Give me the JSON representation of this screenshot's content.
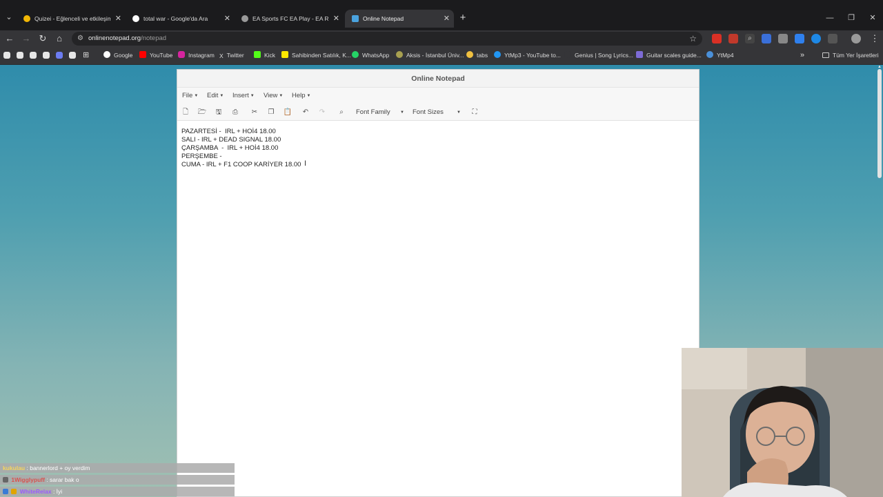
{
  "browser": {
    "tabs": [
      {
        "title": "Quizei - Eğlenceli ve etkileşimli",
        "active": false,
        "fav_color": "#f2b705"
      },
      {
        "title": "total war - Google'da Ara",
        "active": false,
        "fav_color": "#ffffff"
      },
      {
        "title": "EA Sports FC EA Play - EA Resm",
        "active": false,
        "fav_color": "#9a9a9a"
      },
      {
        "title": "Online Notepad",
        "active": true,
        "fav_color": "#4aa3df"
      }
    ],
    "new_tab": "+",
    "window_controls": {
      "minimize": "—",
      "restore": "❐",
      "close": "✕"
    },
    "address": {
      "host": "onlinenotepad.org",
      "path": "/notepad"
    },
    "bookmarks": [
      {
        "label": "Google",
        "icon_color": "#ffffff"
      },
      {
        "label": "YouTube",
        "icon_color": "#ff0000"
      },
      {
        "label": "Instagram",
        "icon_color": "#d6249f"
      },
      {
        "label": "Twitter",
        "icon_color": "#dddddd"
      },
      {
        "label": "Kick",
        "icon_color": "#53fc18"
      },
      {
        "label": "Sahibinden Satılık, K...",
        "icon_color": "#ffe800"
      },
      {
        "label": "WhatsApp",
        "icon_color": "#25d366"
      },
      {
        "label": "Aksis - İstanbul Üniv...",
        "icon_color": "#a8a050"
      },
      {
        "label": "tabs",
        "icon_color": "#f0c040"
      },
      {
        "label": "YtMp3 - YouTube to...",
        "icon_color": "#2196f3"
      },
      {
        "label": "Genius | Song Lyrics...",
        "icon_color": "#353538"
      },
      {
        "label": "Guitar scales guide...",
        "icon_color": "#7d6bd6"
      },
      {
        "label": "YtMp4",
        "icon_color": "#4a90d9"
      }
    ],
    "bookmarks_more": "»",
    "all_bookmarks": "Tüm Yer İşaretleri"
  },
  "notepad": {
    "title": "Online Notepad",
    "menu": [
      "File",
      "Edit",
      "Insert",
      "View",
      "Help"
    ],
    "font_family_label": "Font Family",
    "font_sizes_label": "Font Sizes",
    "lines": [
      "PAZARTESİ -  IRL + HOİ4 18.00",
      "SALI - IRL + DEAD SIGNAL 18.00",
      "ÇARŞAMBA  -  IRL + HOİ4 18.00",
      "PERŞEMBE -",
      "CUMA - IRL + F1 COOP KARİYER 18.00"
    ]
  },
  "chat": [
    {
      "user": "kukulau",
      "message": ": bannerlord + oy verdim",
      "user_color": "#f4d35e"
    },
    {
      "user": "1Wigglypuff",
      "message": ": sarar bak o",
      "user_color": "#d9534f"
    },
    {
      "user": "WhiteRelax",
      "message": ": İyi",
      "user_color": "#9b59ff"
    }
  ]
}
